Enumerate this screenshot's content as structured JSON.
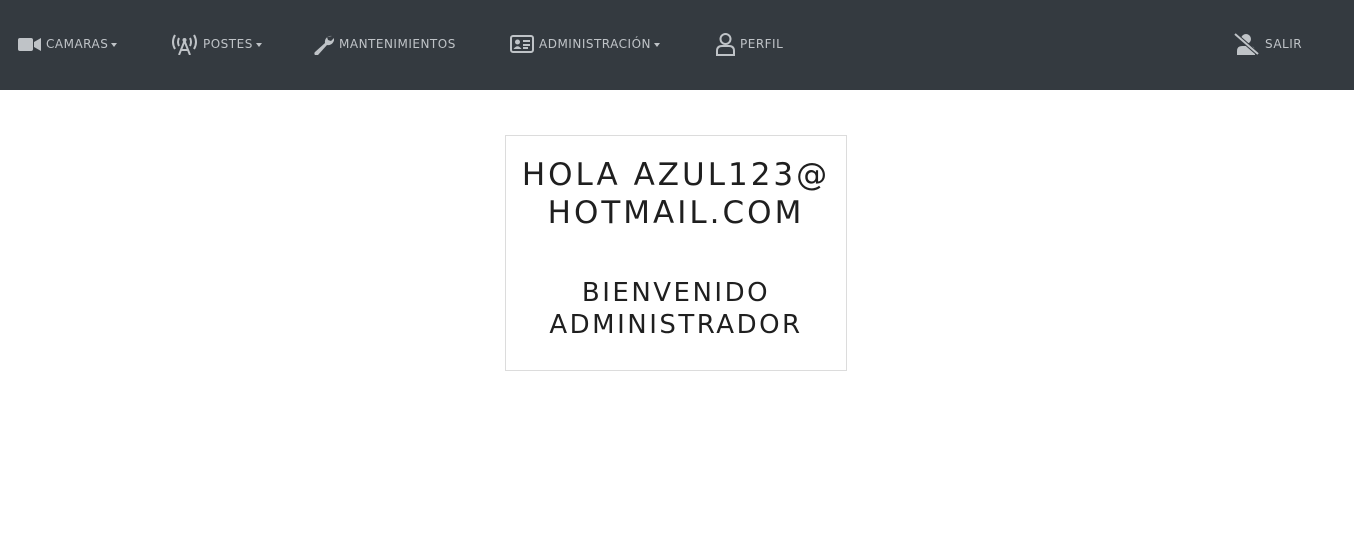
{
  "navbar": {
    "camaras": {
      "label": "CAMARAS",
      "icon": "video-camera-icon",
      "has_dropdown": true
    },
    "postes": {
      "label": "POSTES",
      "icon": "broadcast-tower-icon",
      "has_dropdown": true
    },
    "mantenimientos": {
      "label": "MANTENIMIENTOS",
      "icon": "wrench-icon",
      "has_dropdown": false
    },
    "administracion": {
      "label": "ADMINISTRACIÓN",
      "icon": "id-card-icon",
      "has_dropdown": true
    },
    "perfil": {
      "label": "PERFIL",
      "icon": "user-icon",
      "has_dropdown": false
    },
    "salir": {
      "label": "SALIR",
      "icon": "user-slash-icon",
      "has_dropdown": false
    }
  },
  "card": {
    "greeting": "HOLA AZUL123@HOTMAIL.COM",
    "welcome": "BIENVENIDO ADMINISTRADOR"
  },
  "colors": {
    "navbar_bg": "#343a40",
    "nav_text": "#bfc3c7",
    "card_text": "#1f1f1f",
    "card_border": "#dcdcdc"
  }
}
